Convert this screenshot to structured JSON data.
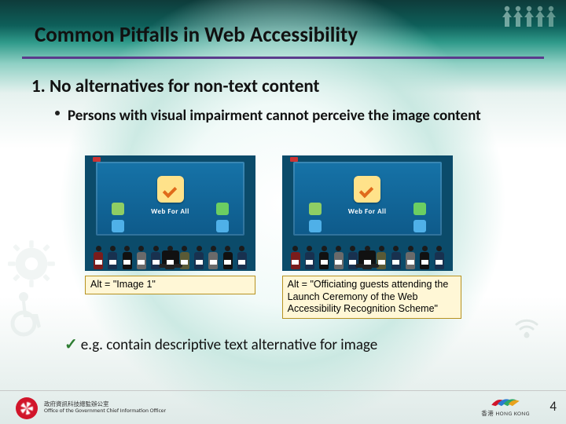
{
  "title": "Common Pitfalls in Web Accessibility",
  "heading": "1.  No alternatives for non-text content",
  "bullet": "Persons with visual impairment cannot perceive the image content",
  "banner_text": "Web For All",
  "alt1": "Alt = \"Image 1\"",
  "alt2": "Alt = \"Officiating guests attending the Launch Ceremony of  the Web Accessibility Recognition Scheme\"",
  "tip": "e.g. contain descriptive text alternative for image",
  "footer_left_line1": "政府資訊科技總監辦公室",
  "footer_left_line2": "Office of the Government Chief Information Officer",
  "footer_right_line1": "香港",
  "footer_right_line2": "HONG KONG",
  "page_number": "4"
}
